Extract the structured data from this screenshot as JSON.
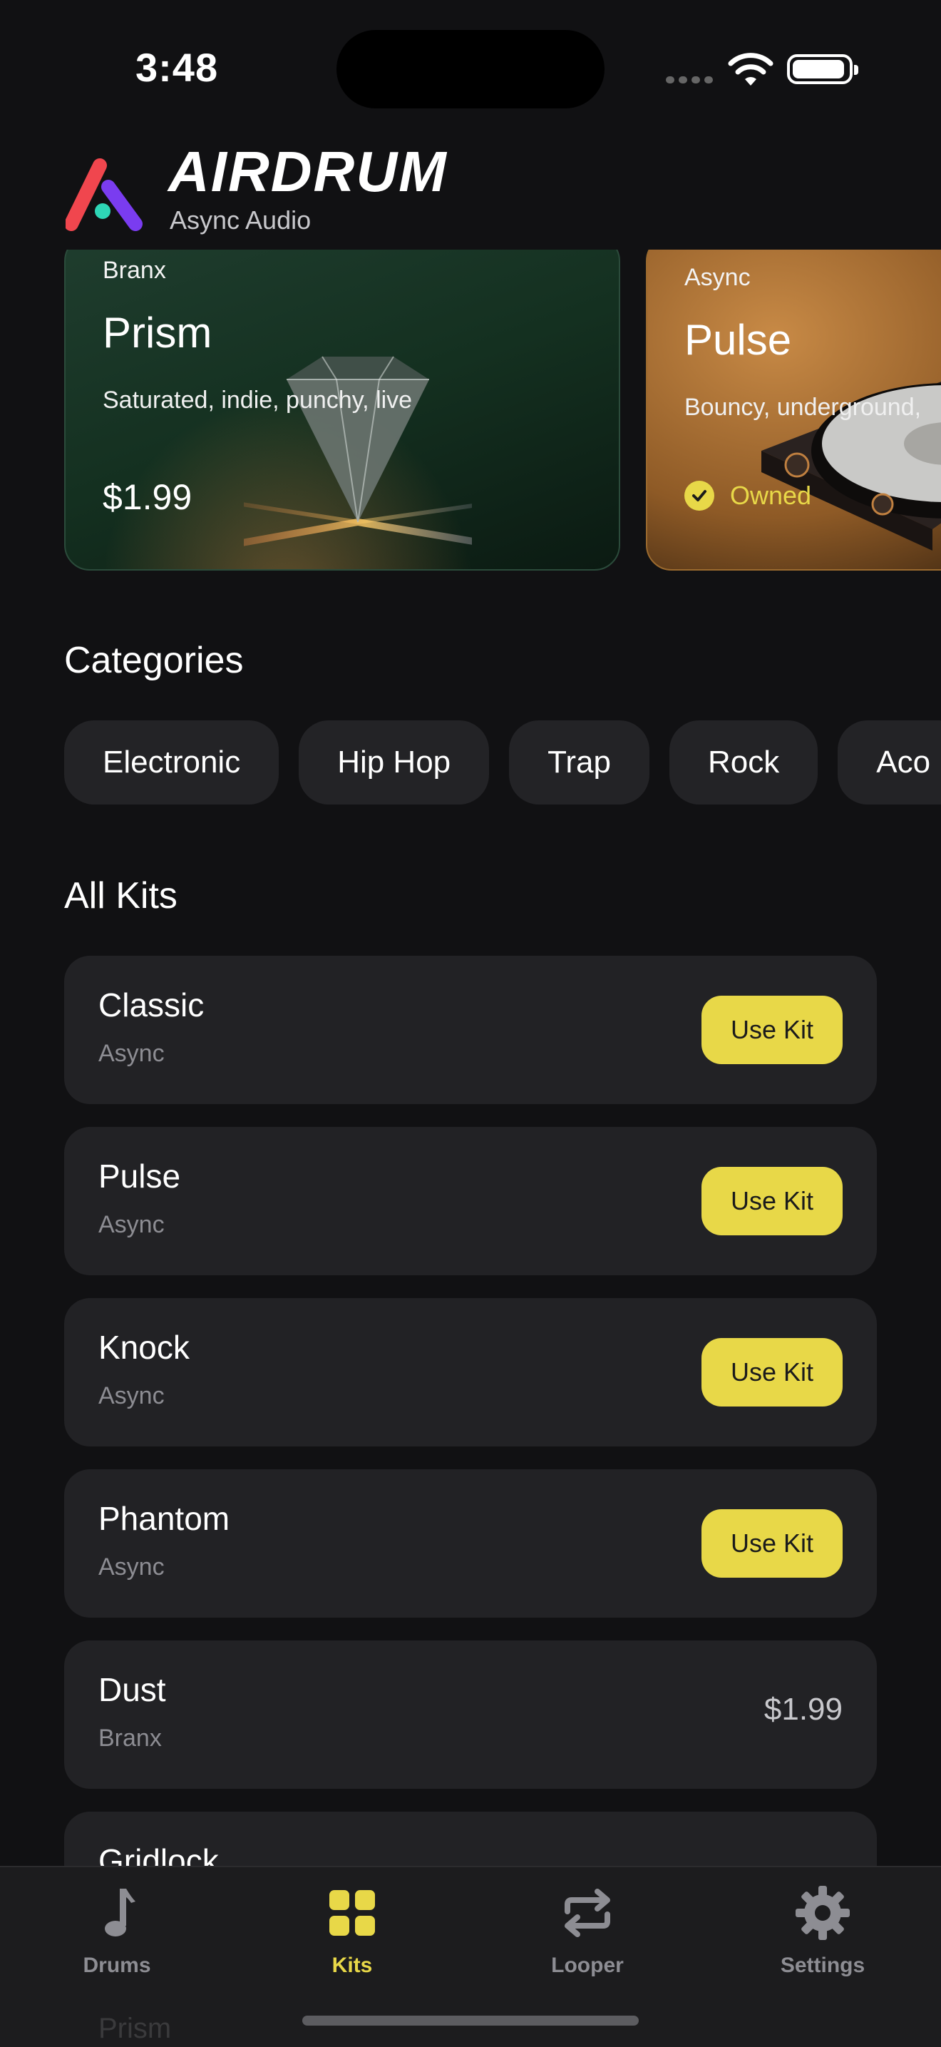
{
  "status_bar": {
    "time": "3:48"
  },
  "header": {
    "title": "AIRDRUM",
    "subtitle": "Async Audio"
  },
  "featured": [
    {
      "brand": "Branx",
      "title": "Prism",
      "description": "Saturated, indie, punchy, live",
      "price": "$1.99"
    },
    {
      "brand": "Async",
      "title": "Pulse",
      "description": "Bouncy, underground,",
      "status": "Owned"
    }
  ],
  "categories": {
    "title": "Categories",
    "items": [
      "Electronic",
      "Hip Hop",
      "Trap",
      "Rock",
      "Aco"
    ]
  },
  "all_kits": {
    "title": "All Kits",
    "action_label": "Use Kit",
    "items": [
      {
        "name": "Classic",
        "brand": "Async"
      },
      {
        "name": "Pulse",
        "brand": "Async"
      },
      {
        "name": "Knock",
        "brand": "Async"
      },
      {
        "name": "Phantom",
        "brand": "Async"
      },
      {
        "name": "Dust",
        "brand": "Branx",
        "price": "$1.99"
      },
      {
        "name": "Gridlock",
        "brand": ""
      }
    ],
    "peek_next": "Prism"
  },
  "tabs": [
    {
      "label": "Drums",
      "icon": "music-note-icon"
    },
    {
      "label": "Kits",
      "icon": "grid-icon",
      "active": true
    },
    {
      "label": "Looper",
      "icon": "repeat-icon"
    },
    {
      "label": "Settings",
      "icon": "gear-icon"
    }
  ],
  "colors": {
    "accent": "#e8d848",
    "background": "#111113",
    "card": "#222225"
  }
}
